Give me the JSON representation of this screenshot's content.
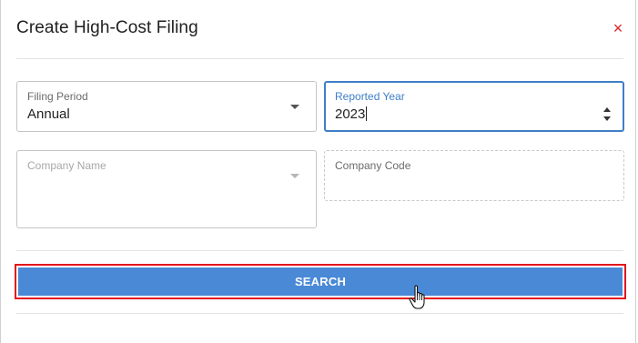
{
  "dialog": {
    "title": "Create High-Cost Filing",
    "close_glyph": "×"
  },
  "form": {
    "filing_period": {
      "label": "Filing Period",
      "value": "Annual"
    },
    "reported_year": {
      "label": "Reported Year",
      "value": "2023"
    },
    "company_name": {
      "label": "Company Name",
      "value": ""
    },
    "company_code": {
      "label": "Company Code",
      "value": ""
    }
  },
  "actions": {
    "search_label": "SEARCH"
  },
  "colors": {
    "accent": "#3f7fc7",
    "button": "#4a89d6",
    "highlight": "#e2161c",
    "close": "#d8232a"
  },
  "icons": {
    "close": "close-icon",
    "dropdown": "chevron-down-icon",
    "spinner": "number-spinner-icon",
    "cursor": "hand-pointer-icon"
  }
}
